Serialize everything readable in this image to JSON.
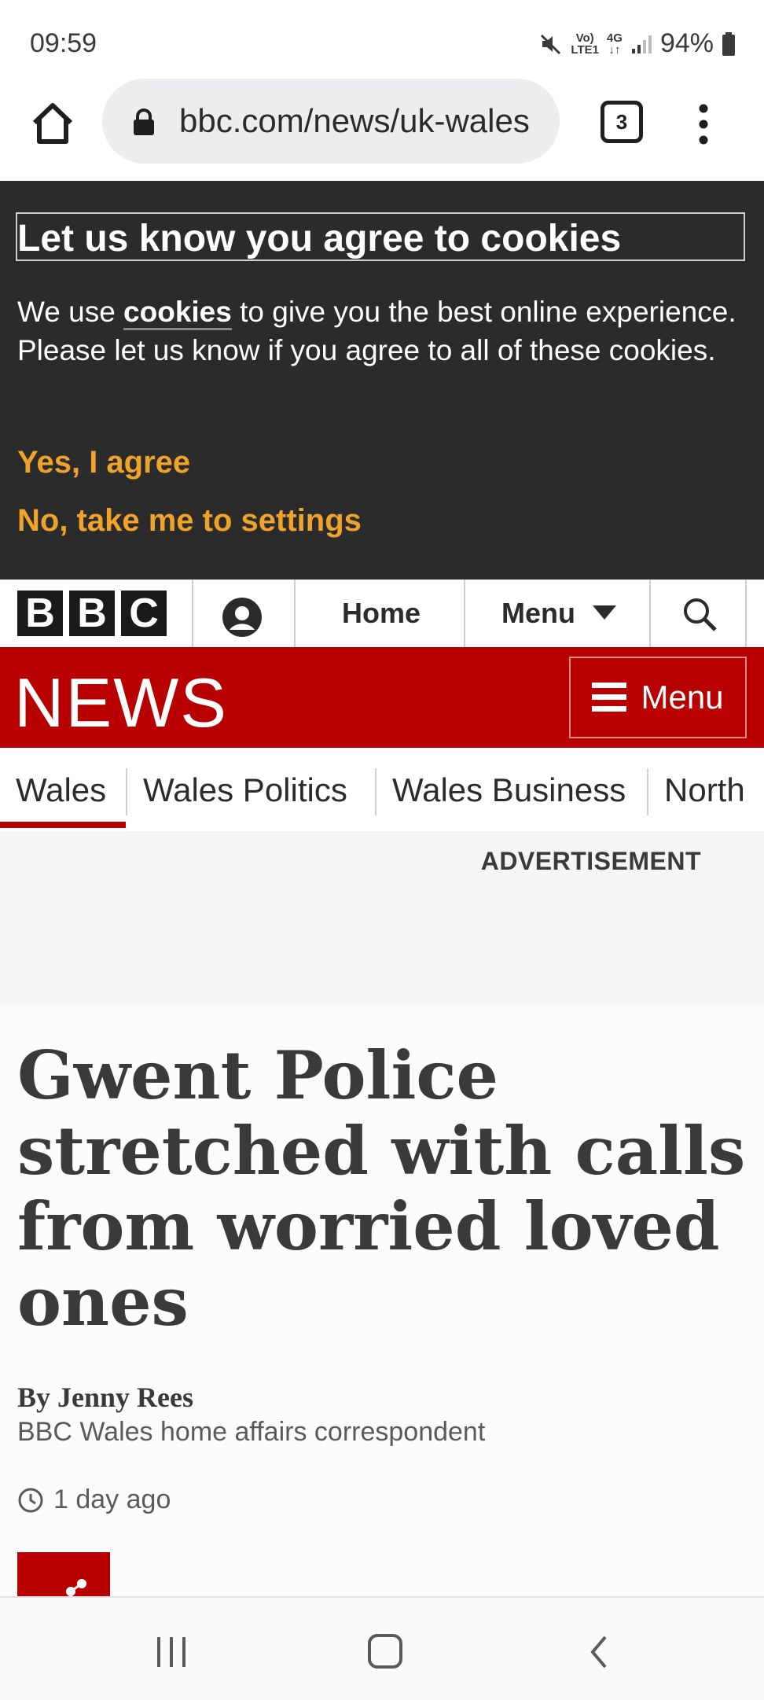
{
  "status_bar": {
    "time": "09:59",
    "volte_top": "Vo)",
    "volte_bottom": "LTE1",
    "network_top": "4G",
    "network_bottom": "↓↑",
    "battery": "94%"
  },
  "browser": {
    "url": "bbc.com/news/uk-wales",
    "tab_count": "3"
  },
  "cookie_banner": {
    "title": "Let us know you agree to cookies",
    "desc_before": "We use ",
    "desc_link": "cookies",
    "desc_after": " to give you the best online experience. Please let us know if you agree to all of these cookies.",
    "agree": "Yes, I agree",
    "settings": "No, take me to settings"
  },
  "bbc_nav": {
    "logo_letters": [
      "B",
      "B",
      "C"
    ],
    "home": "Home",
    "menu": "Menu"
  },
  "news_header": {
    "title": "NEWS",
    "menu": "Menu"
  },
  "section_tabs": [
    "Wales",
    "Wales Politics",
    "Wales Business",
    "North"
  ],
  "ad": {
    "label": "ADVERTISEMENT"
  },
  "article": {
    "headline": "Gwent Police stretched with calls from worried loved ones",
    "byline": "By Jenny Rees",
    "role": "BBC Wales home affairs correspondent",
    "time": "1 day ago"
  },
  "colors": {
    "bbc_red": "#b80000",
    "cookie_bg": "#2b2b2b",
    "cookie_action": "#f0a32b"
  },
  "icons": [
    "home-icon",
    "lock-icon",
    "tab-switcher-icon",
    "more-vert-icon",
    "account-icon",
    "caret-down-icon",
    "search-icon",
    "hamburger-icon",
    "clock-icon",
    "share-icon",
    "recent-apps-icon",
    "home-nav-icon",
    "back-icon"
  ]
}
